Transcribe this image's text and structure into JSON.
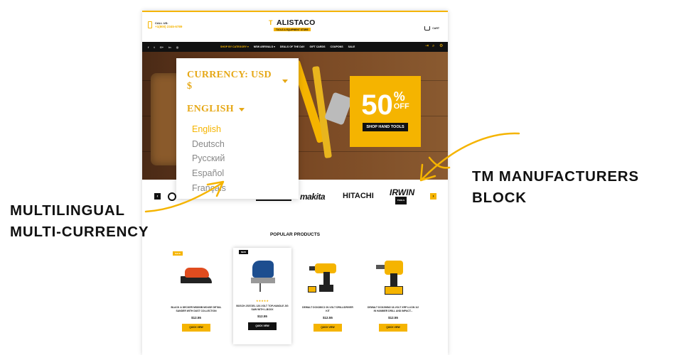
{
  "header": {
    "call_label": "CALL US:",
    "call_number": "+1(800) 2345-6789",
    "logo_text": "ALISTACO",
    "logo_tagline": "TOOLS & EQUIPMENT STORE",
    "cart_label": "CART"
  },
  "social": [
    "f",
    "t",
    "G+",
    "in",
    "◎"
  ],
  "nav": {
    "items": [
      {
        "label": "SHOP BY CATEGORY ▾",
        "active": true
      },
      {
        "label": "NEW ARRIVALS ▾",
        "active": false
      },
      {
        "label": "DEALS OF THE DAY",
        "active": false
      },
      {
        "label": "GIFT CARDS",
        "active": false
      },
      {
        "label": "COUPONS",
        "active": false
      },
      {
        "label": "SALE",
        "active": false
      }
    ],
    "icons": [
      "login-icon",
      "search-icon",
      "settings-icon"
    ]
  },
  "hero": {
    "promo_number": "50",
    "promo_percent": "%",
    "promo_off": "OFF",
    "promo_button": "SHOP HAND TOOLS"
  },
  "dropdown": {
    "currency_label": "CURRENCY: USD $",
    "language_label": "ENGLISH",
    "languages": [
      "English",
      "Deutsch",
      "Русский",
      "Español",
      "Français"
    ],
    "selected_language": "English"
  },
  "brands": {
    "prev": "‹",
    "next": "›",
    "makita": "makita",
    "hitachi": "HITACHI",
    "irwin": "IRWIN",
    "irwin_sub": "TOOLS"
  },
  "products_section": {
    "title": "POPULAR PRODUCTS",
    "items": [
      {
        "badge": "SALE",
        "name": "BLACK & DECKER MS800B MOUSE DETAIL SANDER WITH DUST COLLECTION",
        "price": "$12.55",
        "button": "QUICK VIEW",
        "stars": ""
      },
      {
        "badge": "NEW",
        "name": "BOSCH JS572EL 120-VOLT TOP-HANDLE JIG SAW WITH L-BOXX",
        "price": "$12.55",
        "button": "QUICK VIEW",
        "stars": "★★★★★"
      },
      {
        "badge": "",
        "name": "DEWALT DCK280C2 20-VOLT DRILL/DRIVER KIT",
        "price": "$12.55",
        "button": "QUICK VIEW",
        "stars": ""
      },
      {
        "badge": "",
        "name": "DEWALT DCK296M2 18-VOLT XRP LI-ION 1/2 IN HAMMER DRILL AND IMPACT...",
        "price": "$12.55",
        "button": "QUICK VIEW",
        "stars": ""
      }
    ]
  },
  "callouts": {
    "left_line1": "MULTILINGUAL",
    "left_line2": "MULTI-CURRENCY",
    "right_line1": "TM MANUFACTURERS",
    "right_line2": "BLOCK"
  },
  "colors": {
    "accent": "#f5b400",
    "dark": "#111111",
    "dropdown_heading": "#e6a817",
    "dropdown_item": "#888888"
  }
}
